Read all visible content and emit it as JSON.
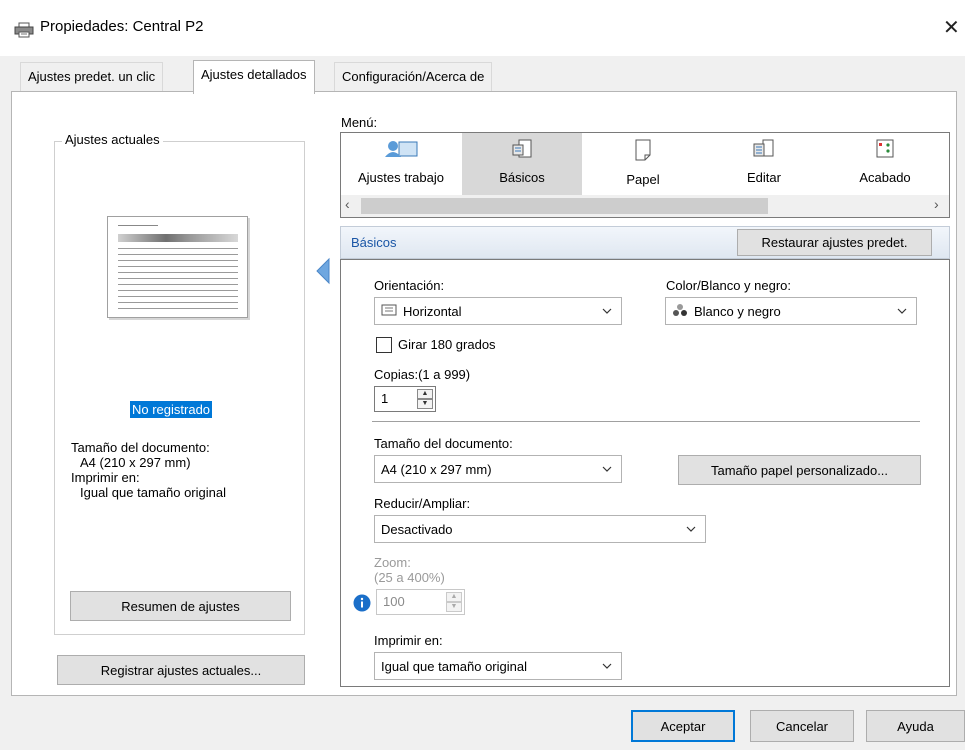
{
  "window": {
    "title": "Propiedades: Central P2",
    "icon": "printer-icon",
    "close_icon": "close-icon"
  },
  "tabs": [
    {
      "label": "Ajustes predet. un clic"
    },
    {
      "label": "Ajustes detallados",
      "active": true
    },
    {
      "label": "Configuración/Acerca de"
    }
  ],
  "left_panel": {
    "group_title": "Ajustes actuales",
    "registration_status": "No registrado",
    "info_lines": [
      "Tamaño del documento:",
      "A4 (210 x 297 mm)",
      "Imprimir en:",
      "Igual que tamaño original"
    ],
    "summary_button": "Resumen de ajustes",
    "register_button": "Registrar ajustes actuales..."
  },
  "menu": {
    "label": "Menú:",
    "items": [
      {
        "label": "Ajustes trabajo",
        "icon": "job-settings-icon"
      },
      {
        "label": "Básicos",
        "icon": "basic-settings-icon",
        "selected": true
      },
      {
        "label": "Papel",
        "icon": "paper-icon"
      },
      {
        "label": "Editar",
        "icon": "edit-icon"
      },
      {
        "label": "Acabado",
        "icon": "finishing-icon"
      }
    ]
  },
  "section": {
    "title": "Básicos",
    "restore_button": "Restaurar ajustes predet."
  },
  "form": {
    "orientation_label": "Orientación:",
    "orientation_value": "Horizontal",
    "color_label": "Color/Blanco y negro:",
    "color_value": "Blanco y negro",
    "rotate_label": "Girar 180 grados",
    "rotate_checked": false,
    "copies_label": "Copias:(1 a 999)",
    "copies_value": "1",
    "doc_size_label": "Tamaño del documento:",
    "doc_size_value": "A4 (210 x 297 mm)",
    "custom_size_button": "Tamaño papel personalizado...",
    "reduce_label": "Reducir/Ampliar:",
    "reduce_value": "Desactivado",
    "zoom_label": "Zoom:",
    "zoom_range": "(25 a 400%)",
    "zoom_value": "100",
    "print_on_label": "Imprimir en:",
    "print_on_value": "Igual que tamaño original"
  },
  "footer": {
    "accept": "Aceptar",
    "cancel": "Cancelar",
    "help": "Ayuda"
  },
  "colors": {
    "accent": "#0078d7",
    "section_title": "#1a56a6",
    "collapse_arrow": "#6fa7e0"
  }
}
